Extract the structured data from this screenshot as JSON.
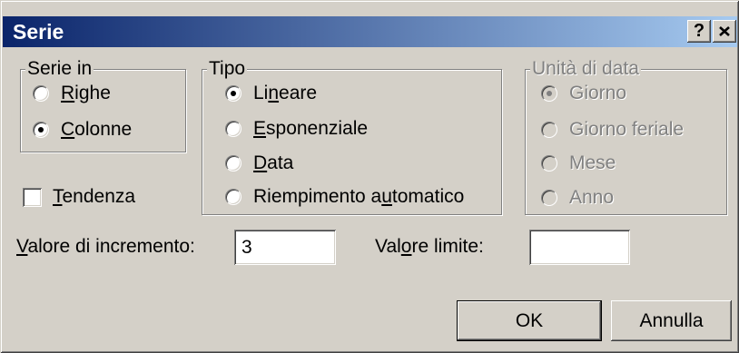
{
  "window": {
    "title": "Serie",
    "help_label": "?",
    "close_icon": "close-icon",
    "colors": {
      "titlebar_start": "#0a246a",
      "titlebar_end": "#a6caf0",
      "face": "#d4d0c8",
      "disabled_text": "#808080"
    }
  },
  "serie_in": {
    "label": "Serie in",
    "enabled": true,
    "options": [
      {
        "label": "Righe",
        "accel": "R",
        "checked": false
      },
      {
        "label": "Colonne",
        "accel": "C",
        "checked": true
      }
    ]
  },
  "tipo": {
    "label": "Tipo",
    "enabled": true,
    "options": [
      {
        "label": "Lineare",
        "accel": "n",
        "checked": true
      },
      {
        "label": "Esponenziale",
        "accel": "E",
        "checked": false
      },
      {
        "label": "Data",
        "accel": "D",
        "checked": false
      },
      {
        "label": "Riempimento automatico",
        "accel": "u",
        "checked": false
      }
    ]
  },
  "unita_di_data": {
    "label": "Unità di data",
    "enabled": false,
    "options": [
      {
        "label": "Giorno",
        "checked": true
      },
      {
        "label": "Giorno feriale",
        "checked": false
      },
      {
        "label": "Mese",
        "checked": false
      },
      {
        "label": "Anno",
        "checked": false
      }
    ]
  },
  "tendenza": {
    "label": "Tendenza",
    "accel": "T",
    "checked": false
  },
  "valore_incremento": {
    "label": "Valore di incremento:",
    "accel": "V",
    "value": "3"
  },
  "valore_limite": {
    "label": "Valore limite:",
    "accel": "o",
    "value": ""
  },
  "buttons": {
    "ok": "OK",
    "cancel": "Annulla"
  }
}
